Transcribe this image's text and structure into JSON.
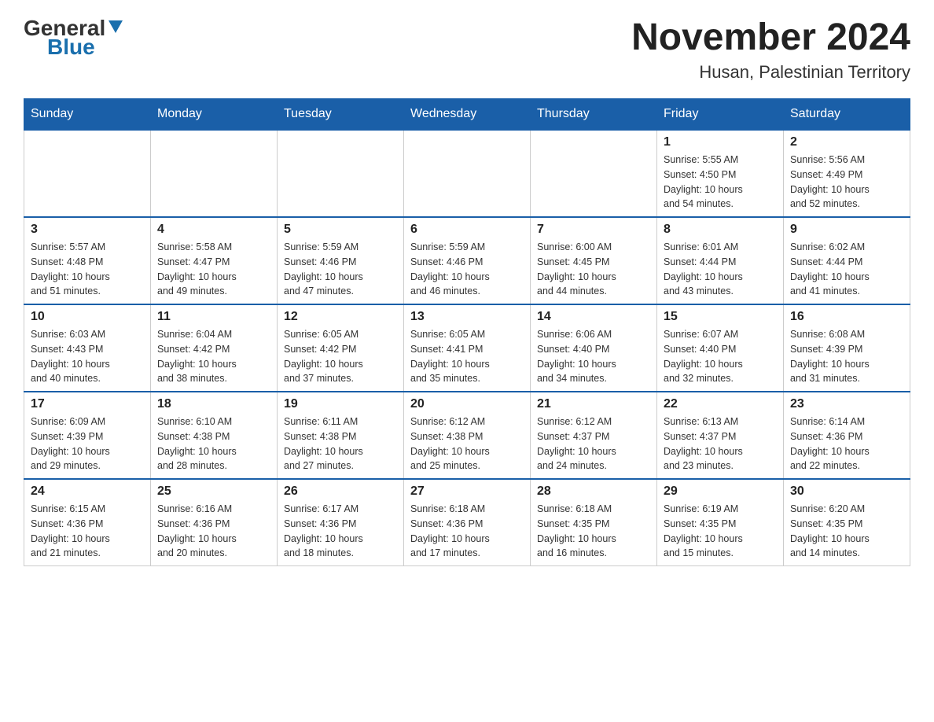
{
  "header": {
    "logo_general": "General",
    "logo_blue": "Blue",
    "title": "November 2024",
    "subtitle": "Husan, Palestinian Territory"
  },
  "weekdays": [
    "Sunday",
    "Monday",
    "Tuesday",
    "Wednesday",
    "Thursday",
    "Friday",
    "Saturday"
  ],
  "weeks": [
    [
      {
        "day": "",
        "info": ""
      },
      {
        "day": "",
        "info": ""
      },
      {
        "day": "",
        "info": ""
      },
      {
        "day": "",
        "info": ""
      },
      {
        "day": "",
        "info": ""
      },
      {
        "day": "1",
        "info": "Sunrise: 5:55 AM\nSunset: 4:50 PM\nDaylight: 10 hours\nand 54 minutes."
      },
      {
        "day": "2",
        "info": "Sunrise: 5:56 AM\nSunset: 4:49 PM\nDaylight: 10 hours\nand 52 minutes."
      }
    ],
    [
      {
        "day": "3",
        "info": "Sunrise: 5:57 AM\nSunset: 4:48 PM\nDaylight: 10 hours\nand 51 minutes."
      },
      {
        "day": "4",
        "info": "Sunrise: 5:58 AM\nSunset: 4:47 PM\nDaylight: 10 hours\nand 49 minutes."
      },
      {
        "day": "5",
        "info": "Sunrise: 5:59 AM\nSunset: 4:46 PM\nDaylight: 10 hours\nand 47 minutes."
      },
      {
        "day": "6",
        "info": "Sunrise: 5:59 AM\nSunset: 4:46 PM\nDaylight: 10 hours\nand 46 minutes."
      },
      {
        "day": "7",
        "info": "Sunrise: 6:00 AM\nSunset: 4:45 PM\nDaylight: 10 hours\nand 44 minutes."
      },
      {
        "day": "8",
        "info": "Sunrise: 6:01 AM\nSunset: 4:44 PM\nDaylight: 10 hours\nand 43 minutes."
      },
      {
        "day": "9",
        "info": "Sunrise: 6:02 AM\nSunset: 4:44 PM\nDaylight: 10 hours\nand 41 minutes."
      }
    ],
    [
      {
        "day": "10",
        "info": "Sunrise: 6:03 AM\nSunset: 4:43 PM\nDaylight: 10 hours\nand 40 minutes."
      },
      {
        "day": "11",
        "info": "Sunrise: 6:04 AM\nSunset: 4:42 PM\nDaylight: 10 hours\nand 38 minutes."
      },
      {
        "day": "12",
        "info": "Sunrise: 6:05 AM\nSunset: 4:42 PM\nDaylight: 10 hours\nand 37 minutes."
      },
      {
        "day": "13",
        "info": "Sunrise: 6:05 AM\nSunset: 4:41 PM\nDaylight: 10 hours\nand 35 minutes."
      },
      {
        "day": "14",
        "info": "Sunrise: 6:06 AM\nSunset: 4:40 PM\nDaylight: 10 hours\nand 34 minutes."
      },
      {
        "day": "15",
        "info": "Sunrise: 6:07 AM\nSunset: 4:40 PM\nDaylight: 10 hours\nand 32 minutes."
      },
      {
        "day": "16",
        "info": "Sunrise: 6:08 AM\nSunset: 4:39 PM\nDaylight: 10 hours\nand 31 minutes."
      }
    ],
    [
      {
        "day": "17",
        "info": "Sunrise: 6:09 AM\nSunset: 4:39 PM\nDaylight: 10 hours\nand 29 minutes."
      },
      {
        "day": "18",
        "info": "Sunrise: 6:10 AM\nSunset: 4:38 PM\nDaylight: 10 hours\nand 28 minutes."
      },
      {
        "day": "19",
        "info": "Sunrise: 6:11 AM\nSunset: 4:38 PM\nDaylight: 10 hours\nand 27 minutes."
      },
      {
        "day": "20",
        "info": "Sunrise: 6:12 AM\nSunset: 4:38 PM\nDaylight: 10 hours\nand 25 minutes."
      },
      {
        "day": "21",
        "info": "Sunrise: 6:12 AM\nSunset: 4:37 PM\nDaylight: 10 hours\nand 24 minutes."
      },
      {
        "day": "22",
        "info": "Sunrise: 6:13 AM\nSunset: 4:37 PM\nDaylight: 10 hours\nand 23 minutes."
      },
      {
        "day": "23",
        "info": "Sunrise: 6:14 AM\nSunset: 4:36 PM\nDaylight: 10 hours\nand 22 minutes."
      }
    ],
    [
      {
        "day": "24",
        "info": "Sunrise: 6:15 AM\nSunset: 4:36 PM\nDaylight: 10 hours\nand 21 minutes."
      },
      {
        "day": "25",
        "info": "Sunrise: 6:16 AM\nSunset: 4:36 PM\nDaylight: 10 hours\nand 20 minutes."
      },
      {
        "day": "26",
        "info": "Sunrise: 6:17 AM\nSunset: 4:36 PM\nDaylight: 10 hours\nand 18 minutes."
      },
      {
        "day": "27",
        "info": "Sunrise: 6:18 AM\nSunset: 4:36 PM\nDaylight: 10 hours\nand 17 minutes."
      },
      {
        "day": "28",
        "info": "Sunrise: 6:18 AM\nSunset: 4:35 PM\nDaylight: 10 hours\nand 16 minutes."
      },
      {
        "day": "29",
        "info": "Sunrise: 6:19 AM\nSunset: 4:35 PM\nDaylight: 10 hours\nand 15 minutes."
      },
      {
        "day": "30",
        "info": "Sunrise: 6:20 AM\nSunset: 4:35 PM\nDaylight: 10 hours\nand 14 minutes."
      }
    ]
  ]
}
